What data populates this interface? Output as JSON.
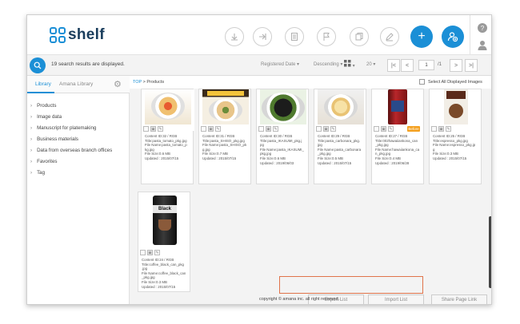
{
  "header": {
    "logo_text": "shelf",
    "tools": [
      "download-icon",
      "upload-icon",
      "document-icon",
      "flag-icon",
      "copy-icon",
      "edit-icon"
    ],
    "add_label": "+",
    "help_label": "?",
    "accent": "#1b8fd6"
  },
  "searchbar": {
    "result_text": "19 search results are displayed.",
    "sort_field": "Registered Date",
    "sort_order": "Descending",
    "per_page": "20",
    "page_current": "1",
    "page_total": "/1"
  },
  "sidebar": {
    "tabs": [
      "Library",
      "Amana Library"
    ],
    "items": [
      "Products",
      "Image data",
      "Manuscript for platemaking",
      "Business materials",
      "Data from overseas branch offices",
      "Favorites",
      "Tag"
    ]
  },
  "breadcrumb": {
    "top": "TOP",
    "sep": ">",
    "current": "Products"
  },
  "select_all_label": "Select All Displayed Images",
  "cards": [
    {
      "lines": [
        "Content ID:32 / RGB",
        "Title:pasta_tomato_pkg.jpg",
        "File Name:pasta_tomato_p",
        "kg.jpg",
        "File Size:0.6 MB",
        "Updated : 2015/07/15"
      ],
      "badge": ""
    },
    {
      "lines": [
        "Content ID:31 / RGB",
        "Title:pasta_SHISO_pkg.jpg",
        "File Name:pasta_SHISO_pk",
        "g.jpg",
        "File Size:0.7 MB",
        "Updated : 2015/07/15"
      ],
      "badge": ""
    },
    {
      "lines": [
        "Content ID:30 / RGB",
        "Title:pasta_IKASUMI_pkg.j",
        "pg",
        "File Name:pasta_IKASUMI_",
        "pkg.jpg",
        "File Size:0.6 MB",
        "Updated : 2019/06/03"
      ],
      "badge": ""
    },
    {
      "lines": [
        "Content ID:29 / RGB",
        "Title:pasta_carbonara_pkg.",
        "jpg",
        "File Name:pasta_carbonara",
        "_pkg.jpg",
        "File Size:0.5 MB",
        "Updated : 2015/07/15"
      ],
      "badge": ""
    },
    {
      "lines": [
        "Content ID:27 / RGB",
        "Title:002hawaiiankona_can",
        "_pkg.jpg",
        "File Name:hawaiiankona_ca",
        "n_pkg.jpg",
        "File Size:0.4 MB",
        "Updated : 2019/06/28"
      ],
      "badge": "Before"
    },
    {
      "lines": [
        "Content ID:25 / RGB",
        "Title:espresso_pkg.jpg",
        "File Name:espresso_pkg.jp",
        "g",
        "File Size:0.3 MB",
        "Updated : 2015/07/15"
      ],
      "badge": ""
    },
    {
      "lines": [
        "Content ID:24 / RGB",
        "Title:coffee_black_can_pkg",
        ".jpg",
        "File Name:coffee_black_can",
        "_pkg.jpg",
        "File Size:0.3 MB",
        "Updated : 2015/07/15"
      ],
      "badge": ""
    }
  ],
  "buttons": {
    "export": "Export List",
    "import": "Import List",
    "share": "Share Page Link"
  },
  "footer": "copyright © amana inc. all right reserved.",
  "can_label": "Black"
}
